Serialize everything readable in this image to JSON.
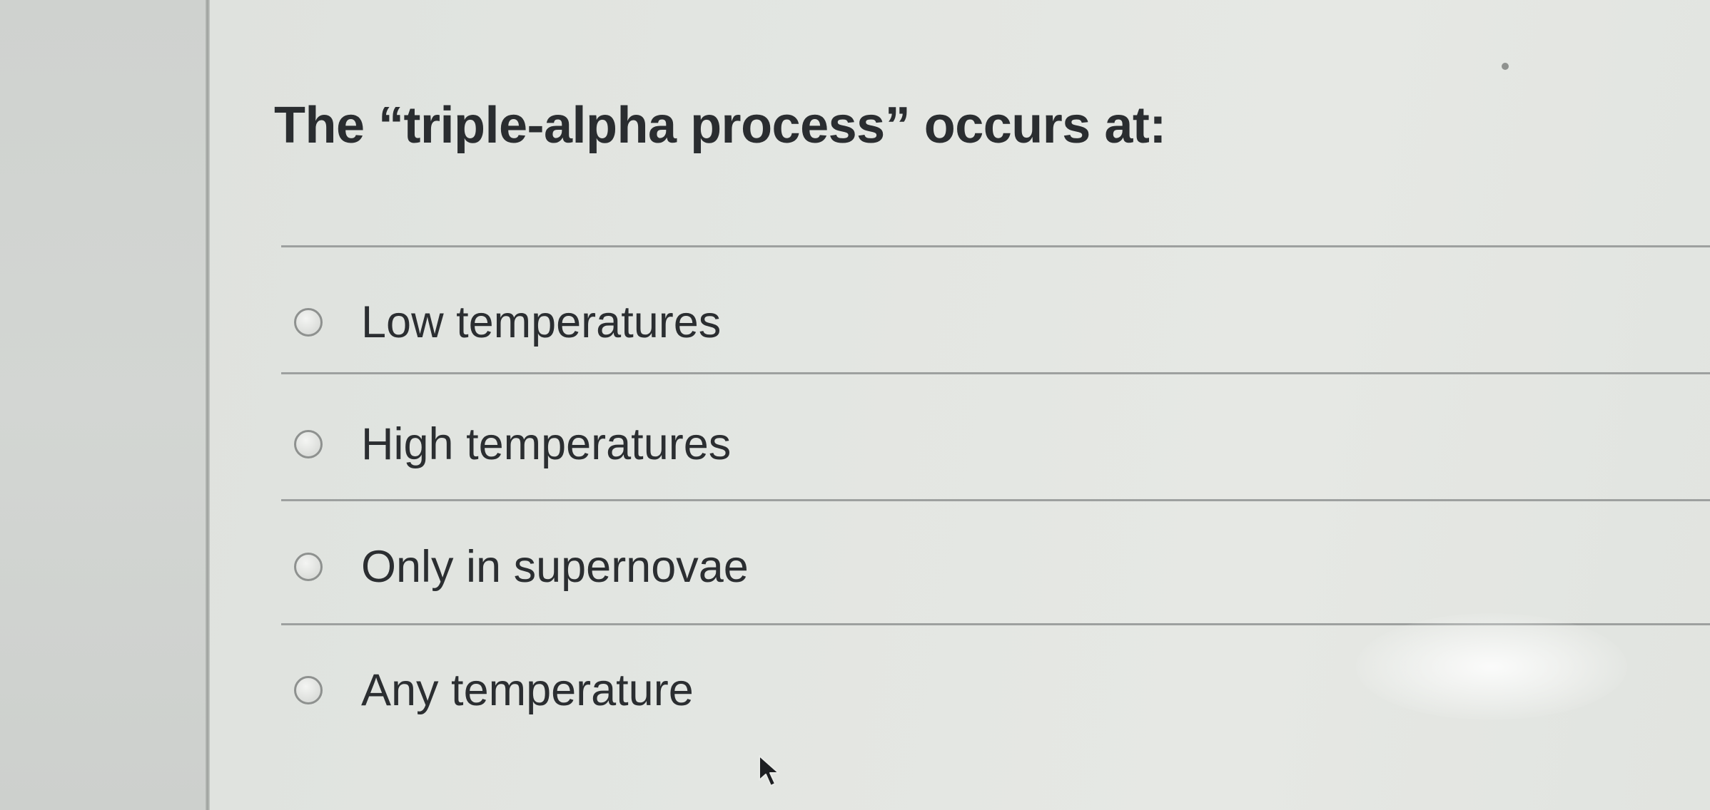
{
  "question": {
    "text": "The “triple-alpha process” occurs at:"
  },
  "options": [
    {
      "label": "Low temperatures",
      "selected": false
    },
    {
      "label": "High temperatures",
      "selected": false
    },
    {
      "label": "Only in supernovae",
      "selected": false
    },
    {
      "label": "Any temperature",
      "selected": false
    }
  ],
  "icons": {
    "radio": "radio-button-unchecked",
    "cursor": "mouse-pointer"
  },
  "colors": {
    "text": "#2a2d30",
    "divider": "#9da09f",
    "background": "#e3e6e2"
  }
}
